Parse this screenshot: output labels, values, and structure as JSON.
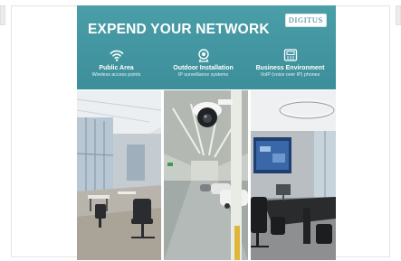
{
  "banner": {
    "title": "EXPEND YOUR NETWORK",
    "logo_text": "DIGITUS",
    "features": [
      {
        "icon": "wifi-icon",
        "heading": "Public Area",
        "sub": "Wireless access points"
      },
      {
        "icon": "camera-icon",
        "heading": "Outdoor Installation",
        "sub": "IP surveillance systems"
      },
      {
        "icon": "phone-icon",
        "heading": "Business Environment",
        "sub": "VoIP (voice over IP) phones"
      }
    ],
    "photos": [
      {
        "name": "public-area-photo"
      },
      {
        "name": "parking-garage-camera-photo"
      },
      {
        "name": "conference-room-photo"
      }
    ]
  },
  "colors": {
    "header": "#4a9ea8",
    "text": "#ffffff"
  }
}
